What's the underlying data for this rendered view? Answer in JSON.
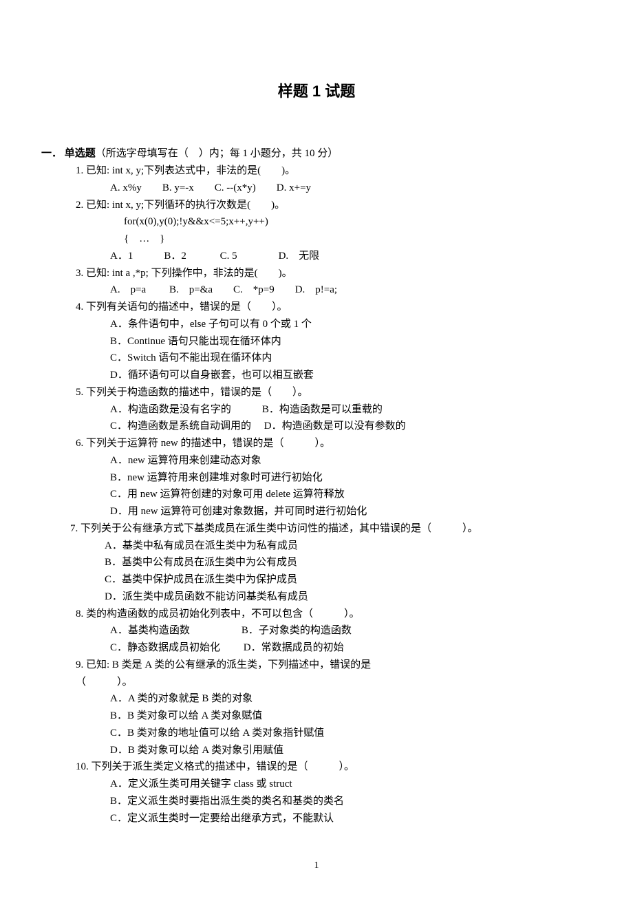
{
  "title": "样题 1 试题",
  "section": {
    "num": "一．",
    "name": "单选题",
    "desc": "（所选字母填写在（　）内；每 1 小题分，共 10 分）"
  },
  "q1": {
    "stem": "1. 已知: int x, y;下列表达式中，非法的是(　　)。",
    "opts": "A. x%y　　B. y=-x　　C. --(x*y)　　D. x+=y"
  },
  "q2": {
    "stem": "2. 已知: int x, y;下列循环的执行次数是(　　)。",
    "code1": "for(x(0),y(0);!y&&x<=5;x++,y++)",
    "code2": "{　…　}",
    "opts": "A．1　　　B．2　　　 C. 5　　　　D.　无限"
  },
  "q3": {
    "stem": "3. 已知: int a ,*p; 下列操作中，非法的是(　　)。",
    "opts": "A.　p=a　　 B.　p=&a　　C.　*p=9　　D.　p!=a;"
  },
  "q4": {
    "stem": "4. 下列有关语句的描述中，错误的是（　　）。",
    "a": "A．条件语句中，else 子句可以有 0 个或 1 个",
    "b": "B．Continue 语句只能出现在循环体内",
    "c": "C．Switch 语句不能出现在循环体内",
    "d": "D．循环语句可以自身嵌套，也可以相互嵌套"
  },
  "q5": {
    "stem": "5. 下列关于构造函数的描述中，错误的是（　　）。",
    "line1": "A．构造函数是没有名字的　　　B．构造函数是可以重载的",
    "line2": "C．构造函数是系统自动调用的　 D．构造函数是可以没有参数的"
  },
  "q6": {
    "stem": "6. 下列关于运算符 new 的描述中，错误的是（　　　）。",
    "a": "A．new 运算符用来创建动态对象",
    "b": "B．new 运算符用来创建堆对象时可进行初始化",
    "c": "C．用 new 运算符创建的对象可用 delete 运算符释放",
    "d": "D．用 new 运算符可创建对象数据，并可同时进行初始化"
  },
  "q7": {
    "stem": "7. 下列关于公有继承方式下基类成员在派生类中访问性的描述，其中错误的是（　　　）。",
    "a": "A．基类中私有成员在派生类中为私有成员",
    "b": "B．基类中公有成员在派生类中为公有成员",
    "c": "C．基类中保护成员在派生类中为保护成员",
    "d": "D．派生类中成员函数不能访问基类私有成员"
  },
  "q8": {
    "stem": "8. 类的构造函数的成员初始化列表中，不可以包含（　　　）。",
    "line1": "A．基类构造函数　　　　　B．子对象类的构造函数",
    "line2": "C．静态数据成员初始化　　 D．常数据成员的初始"
  },
  "q9": {
    "stem1": "9. 已知: B 类是 A 类的公有继承的派生类，下列描述中，错误的是",
    "stem2": "（　　　）。",
    "a": "A．A 类的对象就是 B 类的对象",
    "b": "B．B 类对象可以给 A 类对象赋值",
    "c": "C．B 类对象的地址值可以给 A 类对象指针赋值",
    "d": "D．B 类对象可以给 A 类对象引用赋值"
  },
  "q10": {
    "stem": "10. 下列关于派生类定义格式的描述中，错误的是（　　　）。",
    "a": "A．定义派生类可用关键字 class 或 struct",
    "b": "B．定义派生类时要指出派生类的类名和基类的类名",
    "c": "C．定义派生类时一定要给出继承方式，不能默认"
  },
  "pageNum": "1"
}
